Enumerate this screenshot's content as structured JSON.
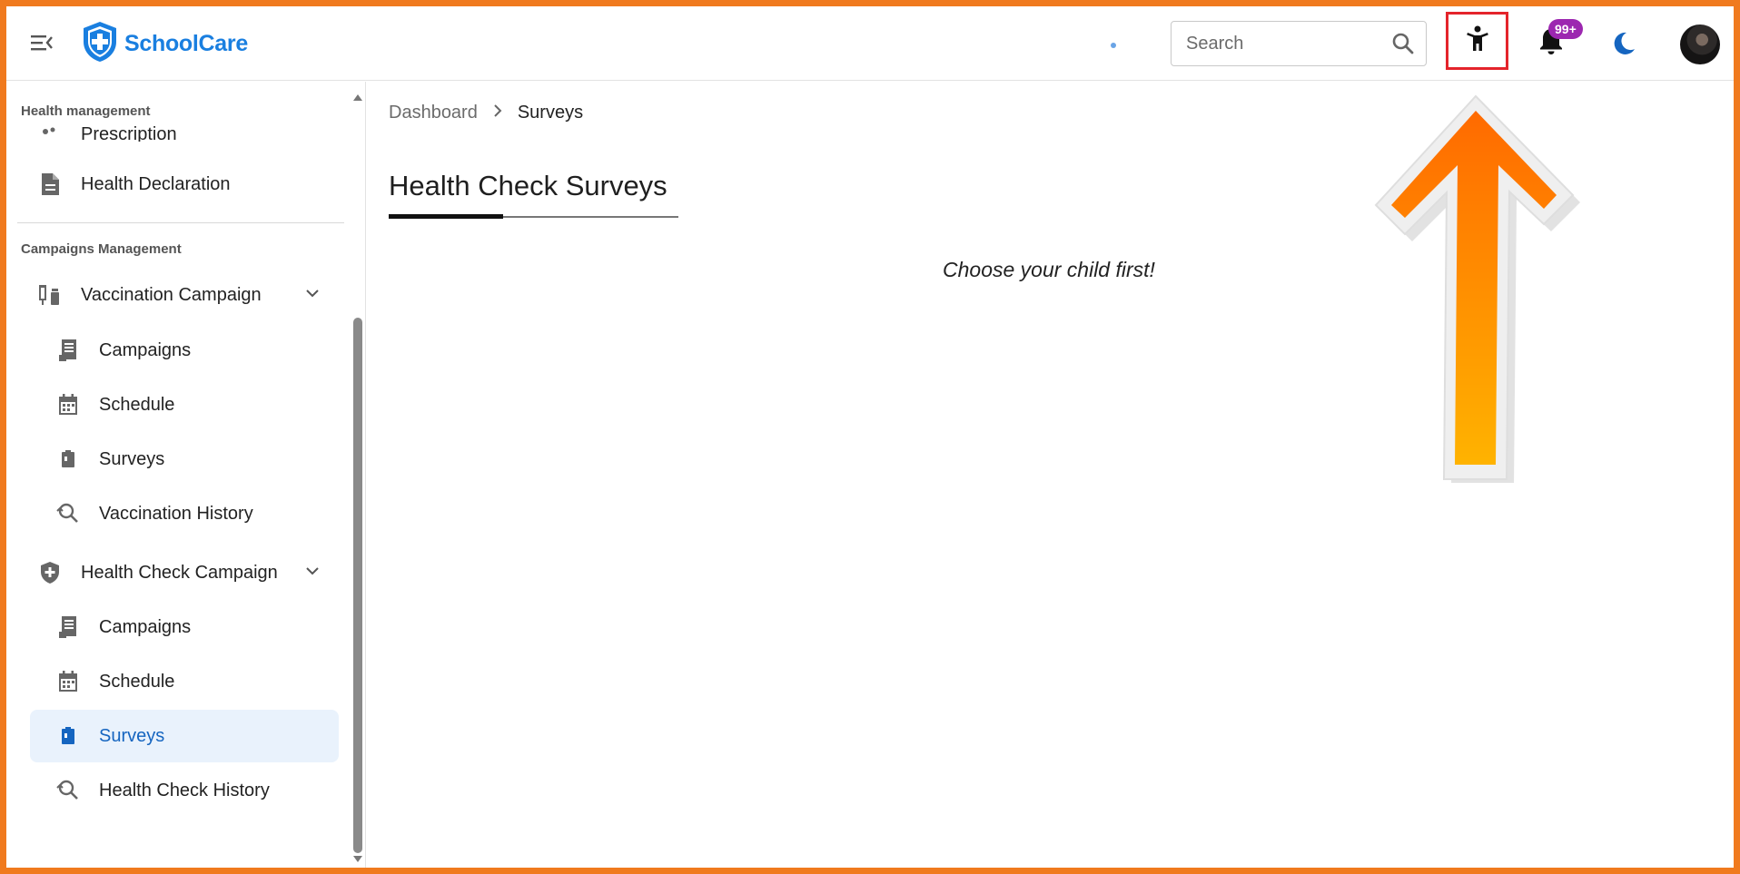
{
  "app": {
    "name": "SchoolCare"
  },
  "header": {
    "search_placeholder": "Search",
    "notification_count": "99+"
  },
  "sidebar": {
    "section_health": "Health management",
    "item_prescription": "Prescription",
    "item_health_declaration": "Health Declaration",
    "section_campaigns": "Campaigns Management",
    "vaccination": {
      "label": "Vaccination Campaign",
      "campaigns": "Campaigns",
      "schedule": "Schedule",
      "surveys": "Surveys",
      "history": "Vaccination History"
    },
    "health_check": {
      "label": "Health Check Campaign",
      "campaigns": "Campaigns",
      "schedule": "Schedule",
      "surveys": "Surveys",
      "history": "Health Check History"
    }
  },
  "breadcrumb": {
    "home": "Dashboard",
    "current": "Surveys"
  },
  "main": {
    "tab_title": "Health Check Surveys",
    "empty_message": "Choose your child first!"
  },
  "colors": {
    "accent": "#1565c0",
    "highlight_border": "#e4242b",
    "badge": "#9c27b0",
    "frame": "#f07a1e"
  }
}
